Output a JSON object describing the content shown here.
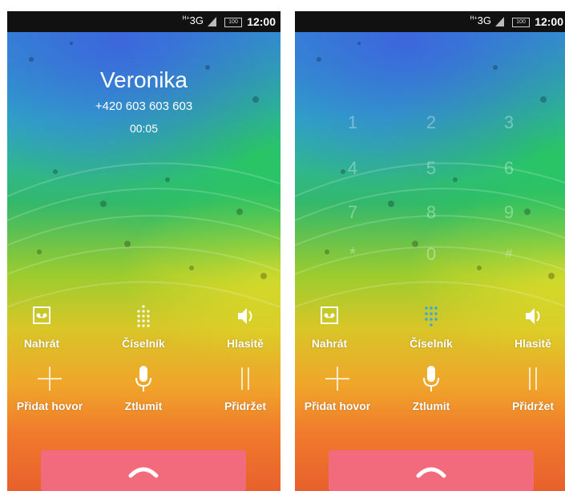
{
  "status_bar": {
    "network": "3G",
    "network_prefix": "H+",
    "battery": "100",
    "time": "12:00"
  },
  "call": {
    "name": "Veronika",
    "number": "+420 603 603 603",
    "duration": "00:05"
  },
  "actions": {
    "record": "Nahrát",
    "keypad": "Číselník",
    "speaker": "Hlasitě",
    "add_call": "Přidat hovor",
    "mute": "Ztlumit",
    "hold": "Přidržet"
  },
  "keypad_keys": [
    "1",
    "2",
    "3",
    "4",
    "5",
    "6",
    "7",
    "8",
    "9",
    "*",
    "0",
    "#"
  ],
  "colors": {
    "end_call": "#f26b7d",
    "keypad_active": "#35a8e0",
    "status_bar": "#111111"
  },
  "icons": {
    "record": "voicemail-icon",
    "keypad": "dialpad-icon",
    "speaker": "speaker-icon",
    "add_call": "plus-icon",
    "mute": "microphone-icon",
    "hold": "pause-icon",
    "end_call": "phone-hangup-icon"
  }
}
